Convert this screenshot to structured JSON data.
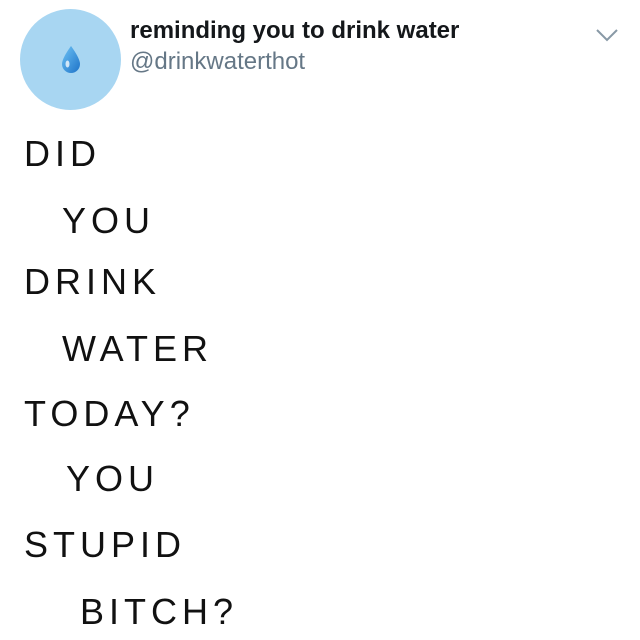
{
  "author": {
    "display_name": "reminding you to drink water",
    "handle": "@drinkwaterthot",
    "avatar_icon": "water-droplet-icon",
    "avatar_color": "#a8d6f2"
  },
  "menu": {
    "icon": "chevron-down-icon"
  },
  "tweet": {
    "lines": [
      "DID",
      "YOU",
      "DRINK",
      "WATER",
      "TODAY?",
      "YOU",
      "STUPID",
      "BITCH?"
    ]
  }
}
